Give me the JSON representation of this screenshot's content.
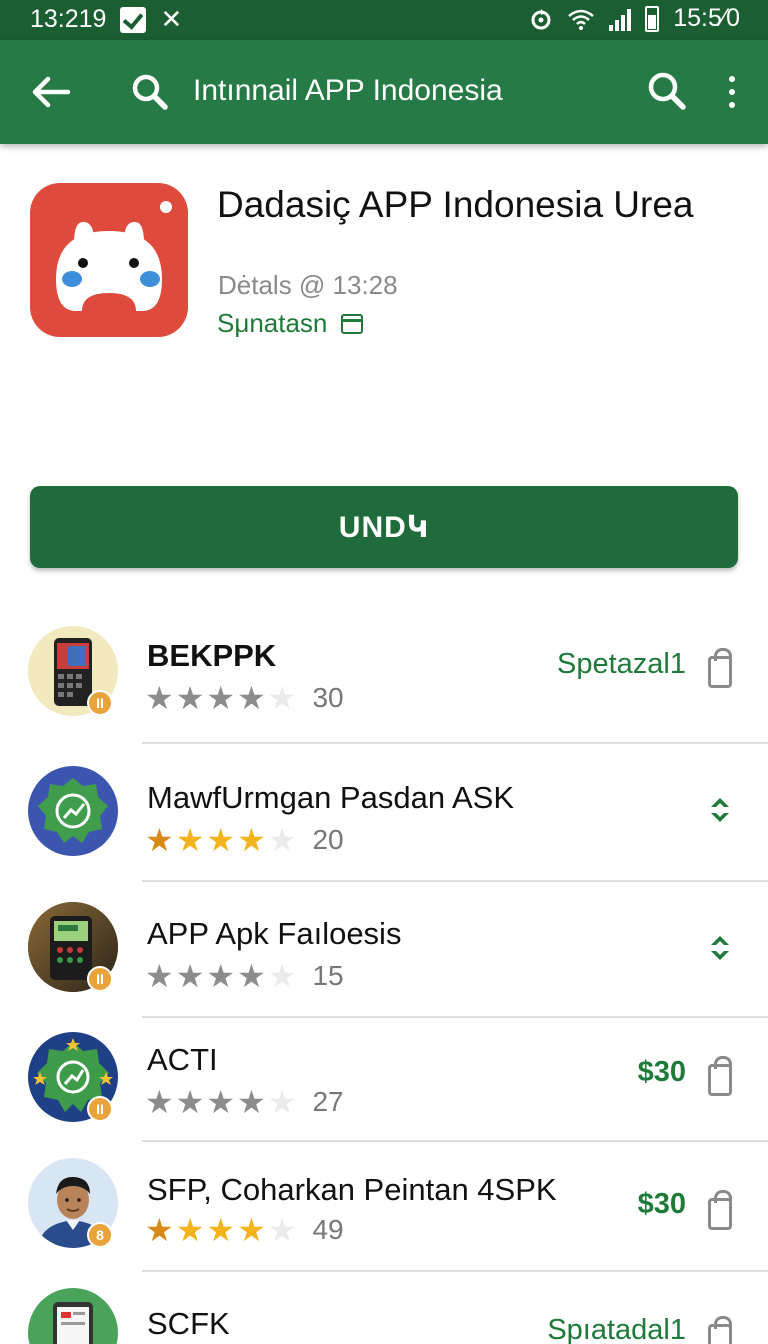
{
  "status_bar": {
    "time_left": "13:219",
    "time_right": "15:5⁄0"
  },
  "app_bar": {
    "title": "Intınnail APP Indonesia"
  },
  "app": {
    "title": "Dadasiç APP Indonesia Urea",
    "meta": "Dėtals @ 13:28",
    "status": "Sμnatasn",
    "icon_color": "#de4b3d"
  },
  "install_button": {
    "label": "UNDԿ"
  },
  "list": [
    {
      "name": "BEKPPK",
      "rating": 4,
      "count": "30",
      "price": "Spetazal1",
      "price_bold": false,
      "action": "bag-icon",
      "star_style": "gray",
      "name_weight": "bold"
    },
    {
      "name": "MawfUrmgan Pasdan ASK",
      "rating": 4,
      "count": "20",
      "price": "",
      "price_bold": false,
      "action": "updown-icon",
      "star_style": "gold",
      "name_weight": "normal"
    },
    {
      "name": "APP Apk Faıloesis",
      "rating": 4,
      "count": "15",
      "price": "",
      "price_bold": false,
      "action": "updown-icon",
      "star_style": "gray",
      "name_weight": "normal"
    },
    {
      "name": "ACTI",
      "rating": 4,
      "count": "27",
      "price": "$30",
      "price_bold": true,
      "action": "bag-icon",
      "star_style": "gray",
      "name_weight": "normal"
    },
    {
      "name": "SFP, Coharkan Peintan 4SPK",
      "rating": 4,
      "count": "49",
      "price": "$30",
      "price_bold": true,
      "action": "bag-icon",
      "star_style": "gold",
      "name_weight": "normal"
    },
    {
      "name": "SCFK",
      "rating": 0,
      "count": "",
      "price": "Spıatadal1",
      "price_bold": false,
      "action": "bag-icon",
      "star_style": "gray",
      "name_weight": "normal"
    }
  ],
  "colors": {
    "status_bar": "#1b5e32",
    "app_bar": "#267a46",
    "accent_green": "#1f7a3a",
    "install_button": "#1f6b3b"
  }
}
